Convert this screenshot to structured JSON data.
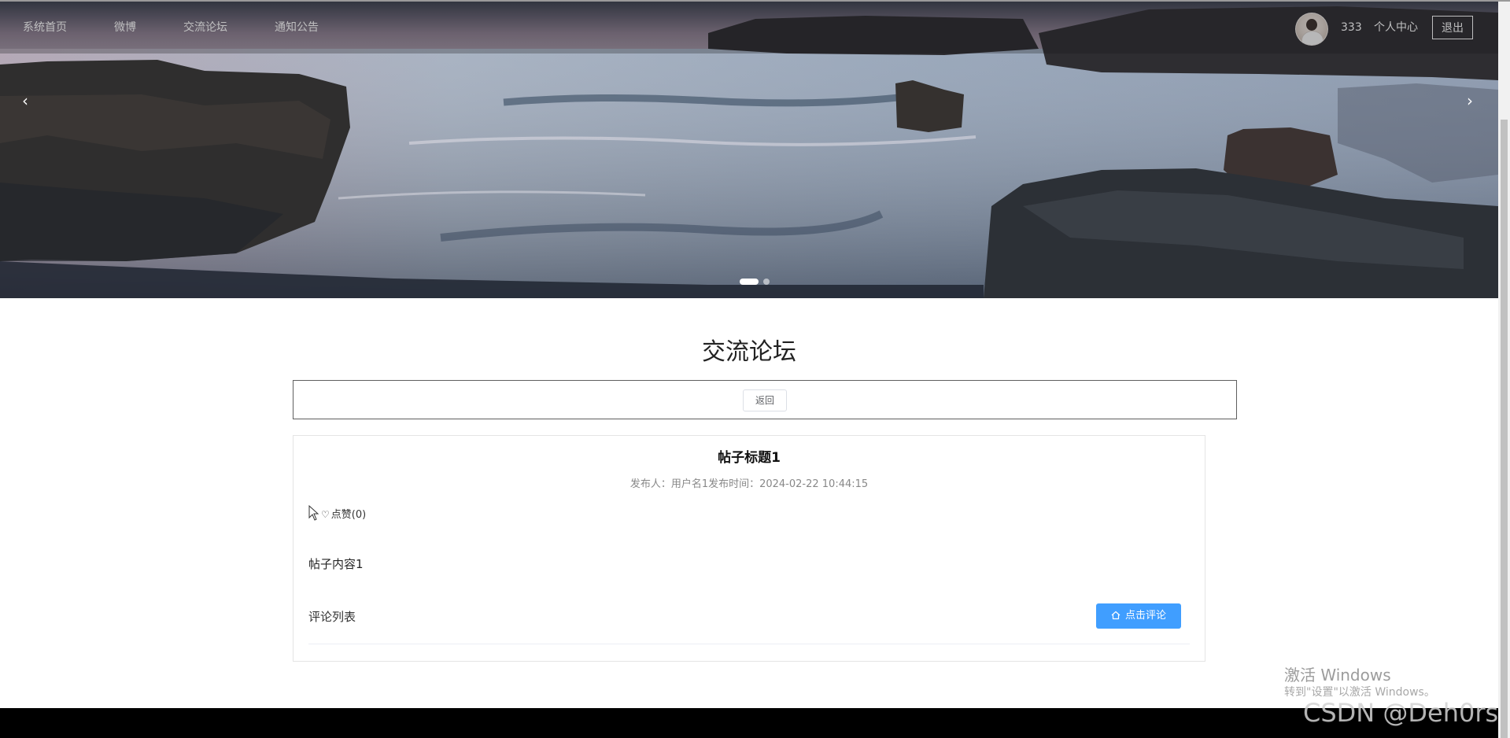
{
  "nav": {
    "items": [
      {
        "label": "系统首页"
      },
      {
        "label": "微博"
      },
      {
        "label": "交流论坛"
      },
      {
        "label": "通知公告"
      }
    ],
    "user_name": "333",
    "user_center": "个人中心",
    "logout": "退出"
  },
  "banner": {
    "prev_arrow": "‹",
    "next_arrow": "›",
    "slide_count": 2,
    "active_slide": 1
  },
  "main": {
    "section_title": "交流论坛",
    "back_label": "返回"
  },
  "post": {
    "title": "帖子标题1",
    "meta": "发布人：用户名1发布时间：2024-02-22 10:44:15",
    "like_label": "点赞(0)",
    "content": "帖子内容1",
    "comments_label": "评论列表",
    "comment_button": "点击评论"
  },
  "watermarks": {
    "windows_title": "激活 Windows",
    "windows_sub": "转到\"设置\"以激活 Windows。",
    "csdn": "CSDN @Deh0rs"
  },
  "colors": {
    "primary": "#409eff",
    "footer": "#000000"
  },
  "icons": [
    "heart-icon",
    "home-icon",
    "cursor-icon",
    "chevron-left-icon",
    "chevron-right-icon"
  ]
}
